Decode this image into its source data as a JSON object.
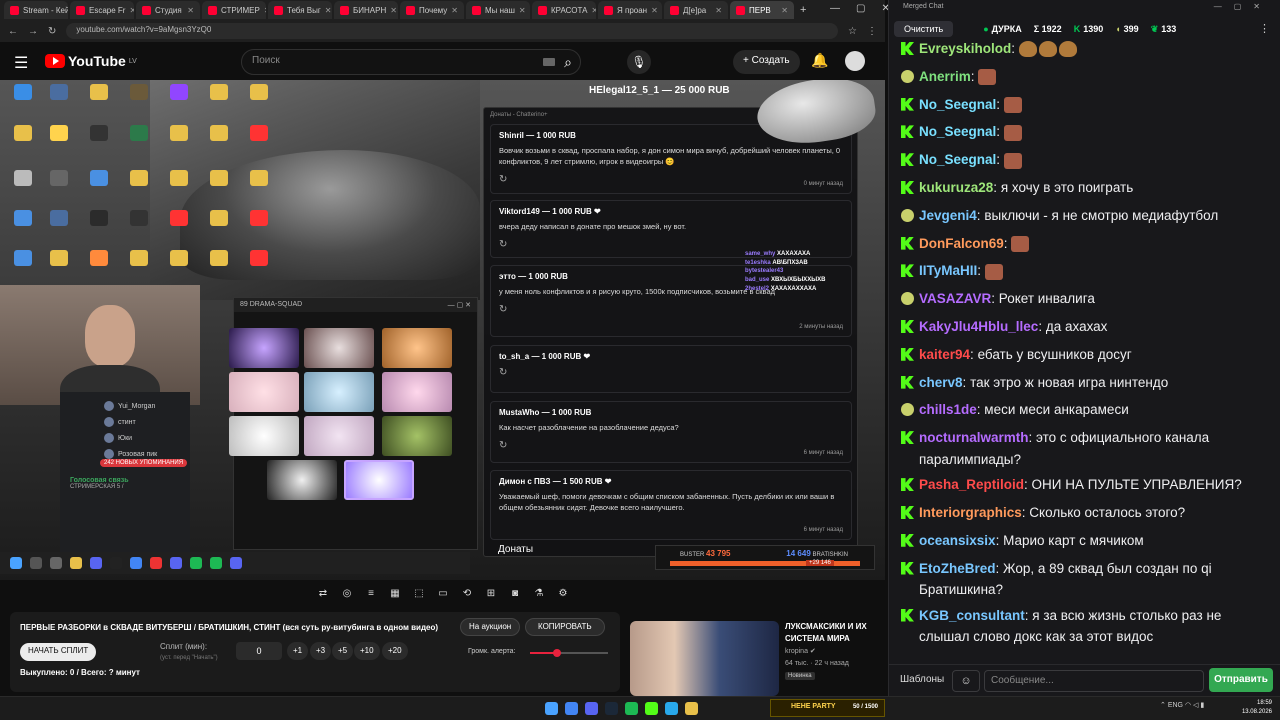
{
  "browser": {
    "tabs": [
      {
        "label": "Stream - Кейс",
        "active": false
      },
      {
        "label": "Escape Fr",
        "active": false
      },
      {
        "label": "Студия",
        "active": false
      },
      {
        "label": "СТРИМЕР",
        "active": false
      },
      {
        "label": "Тебя Выг",
        "active": false
      },
      {
        "label": "БИНАРН",
        "active": false
      },
      {
        "label": "Почему",
        "active": false
      },
      {
        "label": "Мы наш",
        "active": false
      },
      {
        "label": "КРАСОТА",
        "active": false
      },
      {
        "label": "Я проан",
        "active": false
      },
      {
        "label": "Д[е]ра",
        "active": false
      },
      {
        "label": "ПЕРВ",
        "active": true
      }
    ],
    "url": "youtube.com/watch?v=9aMgsn3YzQ0"
  },
  "youtube": {
    "logo": "YouTube",
    "logo_region": "LV",
    "search_placeholder": "Поиск",
    "create_label": "+ Создать"
  },
  "video": {
    "hud_title": "HElegal12_5_1 — 25 000 RUB",
    "donations_header": "Донаты - Chatterino+",
    "donations": [
      {
        "header": "Shinril — 1 000 RUB",
        "text": "Вовчик возьми в сквад, проспала набор, я дон симон мира вичуб, добрейший человек планеты, 0 конфликтов, 9 лет стримлю, игрок в видеоигры 😊",
        "ago": "0 минут назад"
      },
      {
        "header": "Viktord149 — 1 000 RUB ❤",
        "text": "вчера деду написал в донате про мешок змей, ну вот.",
        "ago": ""
      },
      {
        "header": "этто — 1 000 RUB",
        "text": "у меня ноль конфликтов и я рисую круто, 1500к подписчиков, возьмите в сквад",
        "ago": "2 минуты назад"
      },
      {
        "header": "to_sh_a — 1 000 RUB ❤",
        "text": "",
        "ago": ""
      },
      {
        "header": "MustaWho — 1 000 RUB",
        "text": "Как насчет разоблачение на разоблачение дедуса?",
        "ago": "6 минут назад"
      },
      {
        "header": "Димон с ПВЗ — 1 500 RUB ❤",
        "text": "Уважаемый шеф, помоги девочкам с общим списком забаненных. Пусть делбики их или ваши в общем обезьянник сидят. Девочке всего наилучшего.",
        "ago": "6 минут назад"
      }
    ],
    "donations_footer": "Донаты",
    "drama_window_title": "89 DRAMA-SQUAD",
    "discord": {
      "users": [
        "Yui_Morgan",
        "стинт",
        "Юки",
        "Розовая пик"
      ],
      "mentions": "242 НОВЫХ УПОМИНАНИЯ",
      "voice": "Голосовая связь",
      "voice_sub": "СТРИМЕРСКАЯ 5 /"
    },
    "score": {
      "left_name": "BUSTER",
      "left_value": "43 795",
      "right_value": "14 649",
      "right_name": "BRATISHKIN",
      "delta": "+29 146"
    },
    "minichat": [
      {
        "user": "same_why",
        "text": "ХАХАХАХА"
      },
      {
        "user": "te1eshka",
        "text": "АВ\\БПХЗАВ"
      },
      {
        "user": "bytestealer43",
        "text": ""
      },
      {
        "user": "bad_use",
        "text": "ХВХЫХБЫХХЫХВ"
      },
      {
        "user": "2hestel2",
        "text": "ХАХАХАХХАХА"
      }
    ]
  },
  "panel": {
    "video_title": "ПЕРВЫЕ РАЗБОРКИ в СКВАДЕ ВИТУБЕРШ / БРАТИШКИН, СТИНТ (вся суть ру-витубинга в одном видео)",
    "auction_label": "На аукцион",
    "copy_label": "КОПИРОВАТЬ",
    "split_button": "НАЧАТЬ СПЛИТ",
    "split_label": "Сплит (мин):",
    "split_hint": "(уст. перед \"Начать\")",
    "split_value": "0",
    "increments": [
      "+1",
      "+3",
      "+5",
      "+10",
      "+20"
    ],
    "volume_label": "Громк. алерта:",
    "volume_level": 0.35,
    "sold": "Выкуплено: 0 / Всего: ? минут"
  },
  "recommended": {
    "title": "ЛУКСМАКСИКИ И ИХ СИСТЕМА МИРА",
    "channel": "kropina ✔",
    "meta": "64 тыс. · 22 ч назад",
    "badge": "Новинка"
  },
  "taskbar": {
    "widget_label": "HEHE PARTY",
    "widget_count": "50 / 1500",
    "lang": "ENG",
    "time": "18:59",
    "date": "13.08.2026"
  },
  "chat": {
    "window_title": "Merged Chat",
    "clear_label": "Очистить",
    "stats": {
      "channel": "ДУРКА",
      "sigma": "Σ 1922",
      "kick": "1390",
      "viewers": "399",
      "likes": "133"
    },
    "messages": [
      {
        "platform": "kick",
        "user": "Evreyskiholod",
        "color": "#9ee67a",
        "text": "",
        "emotes": 3,
        "emote_kind": "bear"
      },
      {
        "platform": "twitch",
        "user": "Anerrim",
        "color": "#7fe07f",
        "text": "",
        "emotes": 1
      },
      {
        "platform": "kick",
        "user": "No_Seegnal",
        "color": "#79e0ff",
        "text": "",
        "emotes": 1
      },
      {
        "platform": "kick",
        "user": "No_Seegnal",
        "color": "#79e0ff",
        "text": "",
        "emotes": 1
      },
      {
        "platform": "kick",
        "user": "No_Seegnal",
        "color": "#79e0ff",
        "text": "",
        "emotes": 1
      },
      {
        "platform": "kick",
        "user": "kukuruza28",
        "color": "#9ee67a",
        "text": "я хочу в это поиграть",
        "emotes": 0
      },
      {
        "platform": "twitch",
        "user": "Jevgeni4",
        "color": "#79c7ff",
        "text": "выключи - я не смотрю медиафутбол",
        "emotes": 0
      },
      {
        "platform": "kick",
        "user": "DonFalcon69",
        "color": "#ff9a5c",
        "text": "",
        "emotes": 1
      },
      {
        "platform": "kick",
        "user": "IITyMaHII",
        "color": "#79c7ff",
        "text": "",
        "emotes": 1
      },
      {
        "platform": "twitch",
        "user": "VASAZAVR",
        "color": "#b56cff",
        "text": "Рокет инвалига",
        "emotes": 0
      },
      {
        "platform": "kick",
        "user": "KakyJlu4Hblu_llec",
        "color": "#b56cff",
        "text": "да ахахах",
        "emotes": 0
      },
      {
        "platform": "kick",
        "user": "kaiter94",
        "color": "#ff4b4b",
        "text": "ебать у всушников досуг",
        "emotes": 0
      },
      {
        "platform": "kick",
        "user": "cherv8",
        "color": "#79c7ff",
        "text": "так этро ж новая игра нинтендо",
        "emotes": 0
      },
      {
        "platform": "twitch",
        "user": "chills1de",
        "color": "#b56cff",
        "text": "меси меси анкарамеси",
        "emotes": 0
      },
      {
        "platform": "kick",
        "user": "nocturnalwarmth",
        "color": "#b56cff",
        "text": "это с официального канала паралимпиады?",
        "emotes": 0
      },
      {
        "platform": "kick",
        "user": "Pasha_Reptiloid",
        "color": "#ff4b4b",
        "text": "ОНИ НА ПУЛЬТЕ УПРАВЛЕНИЯ?",
        "emotes": 0
      },
      {
        "platform": "kick",
        "user": "Interiorgraphics",
        "color": "#ff9a5c",
        "text": "Сколько осталось этого?",
        "emotes": 0
      },
      {
        "platform": "kick",
        "user": "oceansixsix",
        "color": "#79c7ff",
        "text": "Марио карт с мячиком",
        "emotes": 0
      },
      {
        "platform": "kick",
        "user": "EtoZheBred",
        "color": "#79c7ff",
        "text": "Жор, а 89 сквад был создан по qi Братишкина?",
        "emotes": 0
      },
      {
        "platform": "kick",
        "user": "KGB_consultant",
        "color": "#79c7ff",
        "text": "я за всю жизнь столько раз не слышал слово докс как за этот видос",
        "emotes": 0
      }
    ],
    "templates_label": "Шаблоны",
    "input_placeholder": "Сообщение...",
    "send_label": "Отправить"
  }
}
